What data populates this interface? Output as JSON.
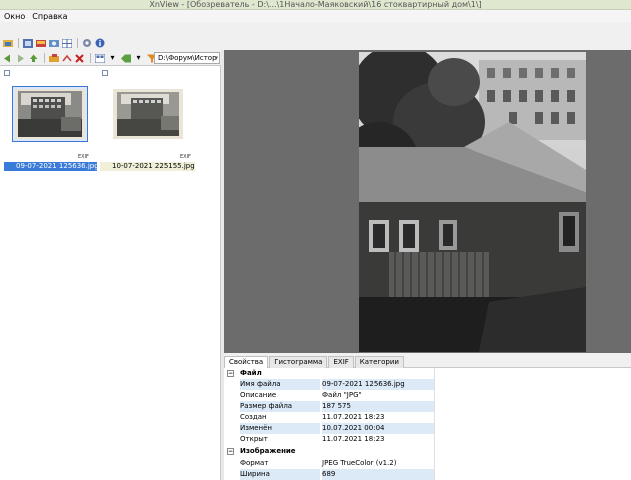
{
  "window": {
    "title": "XnView - [Обозреватель - D:\\...\\1Начало-Маяковский\\16 стоквартирный дом\\1\\]"
  },
  "menu": {
    "items": [
      "Окно",
      "Справка"
    ]
  },
  "toolbar": {
    "path_value": "D:\\Форум\\Истор"
  },
  "browser": {
    "thumbnails": [
      {
        "label": "09-07-2021 125636.jpg",
        "badge": "EXIF",
        "selected": true
      },
      {
        "label": "10-07-2021 225155.jpg",
        "badge": "EXIF",
        "selected": false
      }
    ]
  },
  "info_tabs": [
    "Свойства",
    "Гистограмма",
    "EXIF",
    "Категории"
  ],
  "properties": {
    "group_file": "Файл",
    "rows_file": [
      {
        "key": "Имя файла",
        "value": "09-07-2021 125636.jpg"
      },
      {
        "key": "Описание",
        "value": "Файл \"JPG\""
      },
      {
        "key": "Размер файла",
        "value": "187 575"
      },
      {
        "key": "Создан",
        "value": "11.07.2021 18:23"
      },
      {
        "key": "Изменён",
        "value": "10.07.2021 00:04"
      },
      {
        "key": "Открыт",
        "value": "11.07.2021 18:23"
      }
    ],
    "group_image": "Изображение",
    "rows_image": [
      {
        "key": "Формат",
        "value": "JPEG TrueColor (v1.2)"
      },
      {
        "key": "Ширина",
        "value": "689"
      }
    ]
  },
  "colors": {
    "selection": "#3a7bd9",
    "row_shade": "#dce9f7",
    "viewer_bg": "#6c6c6c"
  }
}
